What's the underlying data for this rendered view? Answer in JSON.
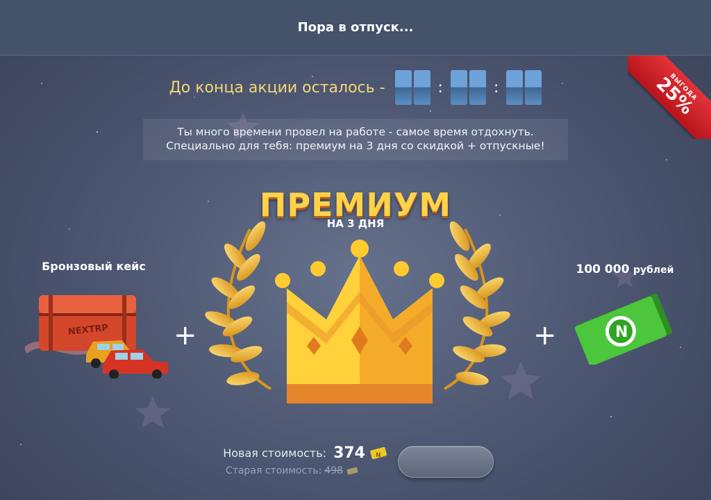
{
  "header": {
    "title": "Пора в отпуск..."
  },
  "ribbon": {
    "small_text": "ВЫГОДА",
    "discount": "25%"
  },
  "timer": {
    "label": "До конца акции осталось -",
    "groups": [
      [
        "",
        ""
      ],
      [
        "",
        ""
      ],
      [
        "",
        ""
      ]
    ],
    "separator": ":"
  },
  "description": {
    "line1": "Ты много времени провел на работе - самое время отдохнуть.",
    "line2": "Специально для тебя: премиум на 3 дня со скидкой + отпускные!"
  },
  "premium": {
    "title": "ПРЕМИУМ",
    "subtitle": "НА 3 ДНЯ"
  },
  "bronze_case": {
    "label": "Бронзовый кейс",
    "box_text": "NEXTRP"
  },
  "money": {
    "amount": "100 000",
    "unit": "рублей",
    "symbol": "N"
  },
  "plus_sign": "+",
  "price": {
    "new_label": "Новая стоимость:",
    "new_value": "374",
    "old_label": "Старая стоимость:",
    "old_value": "498",
    "coin_symbol": "N"
  },
  "buy_button": {
    "label": ""
  },
  "colors": {
    "header_bg": "#44526a",
    "gold": "#ffd24a",
    "timer_blue": "#6ea3d9",
    "ribbon_red": "#d2232a",
    "money_green": "#4cc63c"
  }
}
